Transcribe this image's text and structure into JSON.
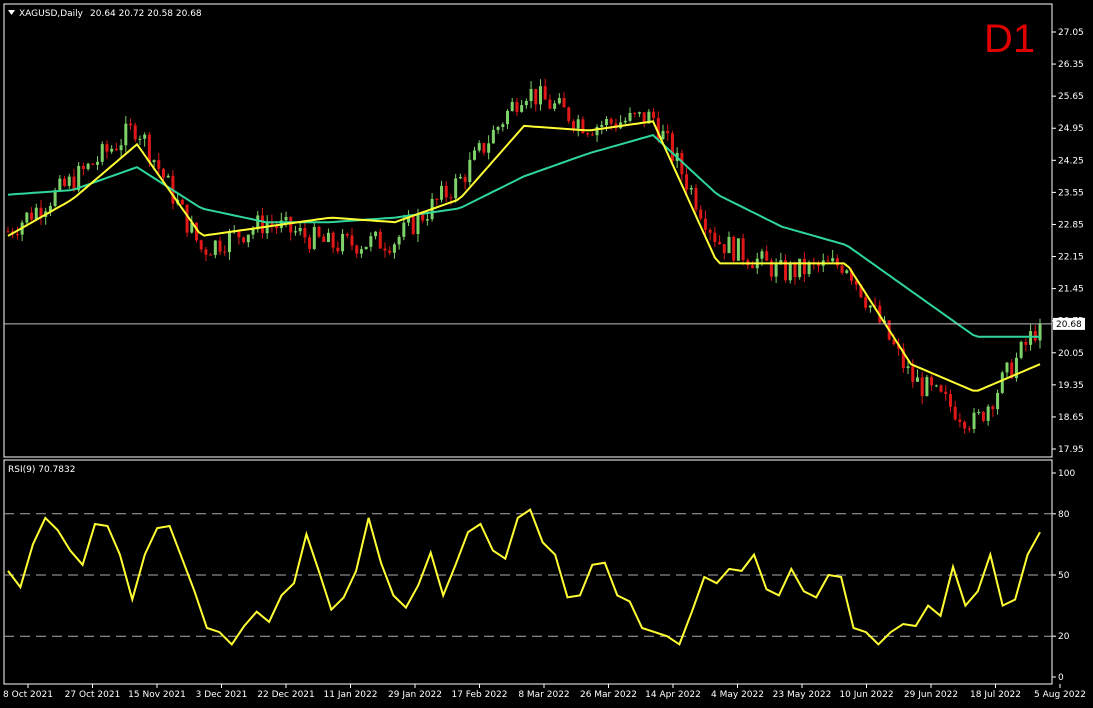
{
  "header": {
    "symbol_line": "XAGUSD,Daily",
    "ohlc_line": "20.64 20.72 20.58 20.68",
    "timeframe_badge": "D1"
  },
  "rsi_header": {
    "label": "RSI(9) 70.7832"
  },
  "current_price": "20.68",
  "colors": {
    "background": "#000000",
    "bull_candle": "#7dd36a",
    "bear_candle": "#e01818",
    "ma_fast": "#ffff33",
    "ma_slow": "#2fd69a",
    "rsi_line": "#ffff33",
    "grid_and_axes": "#ffffff",
    "badge": "#e00000"
  },
  "icons": {
    "symbol_menu": "triangle-down-icon"
  },
  "chart_data": [
    {
      "type": "candlestick",
      "title": "XAGUSD,Daily",
      "y_ticks": [
        "27.05",
        "26.35",
        "25.65",
        "24.95",
        "24.25",
        "23.55",
        "22.85",
        "22.15",
        "21.45",
        "20.75",
        "20.05",
        "19.35",
        "18.65",
        "17.95"
      ],
      "ylim": [
        17.95,
        27.05
      ],
      "x_tick_labels": [
        "8 Oct 2021",
        "27 Oct 2021",
        "15 Nov 2021",
        "3 Dec 2021",
        "22 Dec 2021",
        "11 Jan 2022",
        "29 Jan 2022",
        "17 Feb 2022",
        "8 Mar 2022",
        "26 Mar 2022",
        "14 Apr 2022",
        "4 May 2022",
        "23 May 2022",
        "10 Jun 2022",
        "29 Jun 2022",
        "18 Jul 2022",
        "5 Aug 2022"
      ],
      "x": [
        "8 Oct 2021",
        "27 Oct 2021",
        "15 Nov 2021",
        "3 Dec 2021",
        "22 Dec 2021",
        "11 Jan 2022",
        "29 Jan 2022",
        "17 Feb 2022",
        "8 Mar 2022",
        "26 Mar 2022",
        "14 Apr 2022",
        "4 May 2022",
        "23 May 2022",
        "10 Jun 2022",
        "29 Jun 2022",
        "18 Jul 2022",
        "5 Aug 2022"
      ],
      "series": [
        {
          "kind": "close",
          "values": [
            22.7,
            23.8,
            25.0,
            22.3,
            22.9,
            22.4,
            22.5,
            23.8,
            25.8,
            25.0,
            25.2,
            22.5,
            21.8,
            22.0,
            19.5,
            18.5,
            20.7
          ]
        },
        {
          "kind": "ma_fast",
          "values": [
            22.6,
            23.4,
            24.6,
            22.6,
            22.8,
            23.0,
            22.9,
            23.4,
            25.0,
            24.9,
            25.1,
            22.0,
            22.0,
            22.0,
            19.8,
            19.2,
            19.8
          ]
        },
        {
          "kind": "ma_slow",
          "values": [
            23.5,
            23.6,
            24.1,
            23.2,
            22.9,
            22.9,
            23.0,
            23.2,
            23.9,
            24.4,
            24.8,
            23.5,
            22.8,
            22.4,
            21.4,
            20.4,
            20.4
          ]
        }
      ],
      "last_price": 20.68
    },
    {
      "type": "line",
      "title": "RSI(9) 70.7832",
      "y_ticks": [
        "100",
        "80",
        "50",
        "20",
        "0"
      ],
      "ylim": [
        0,
        100
      ],
      "levels": [
        80,
        50,
        20
      ],
      "values": [
        52,
        44,
        65,
        78,
        72,
        62,
        55,
        75,
        74,
        60,
        38,
        60,
        73,
        74,
        58,
        42,
        24,
        22,
        16,
        25,
        32,
        27,
        40,
        46,
        70,
        52,
        33,
        39,
        52,
        78,
        56,
        40,
        34,
        45,
        61,
        40,
        55,
        71,
        75,
        62,
        58,
        78,
        82,
        66,
        60,
        39,
        40,
        55,
        56,
        40,
        37,
        24,
        22,
        20,
        16,
        32,
        49,
        46,
        53,
        52,
        60,
        43,
        40,
        53,
        42,
        39,
        50,
        49,
        24,
        22,
        16,
        22,
        26,
        25,
        35,
        30,
        54,
        35,
        42,
        60,
        35,
        38,
        60,
        71
      ],
      "last_value": 70.7832
    }
  ]
}
